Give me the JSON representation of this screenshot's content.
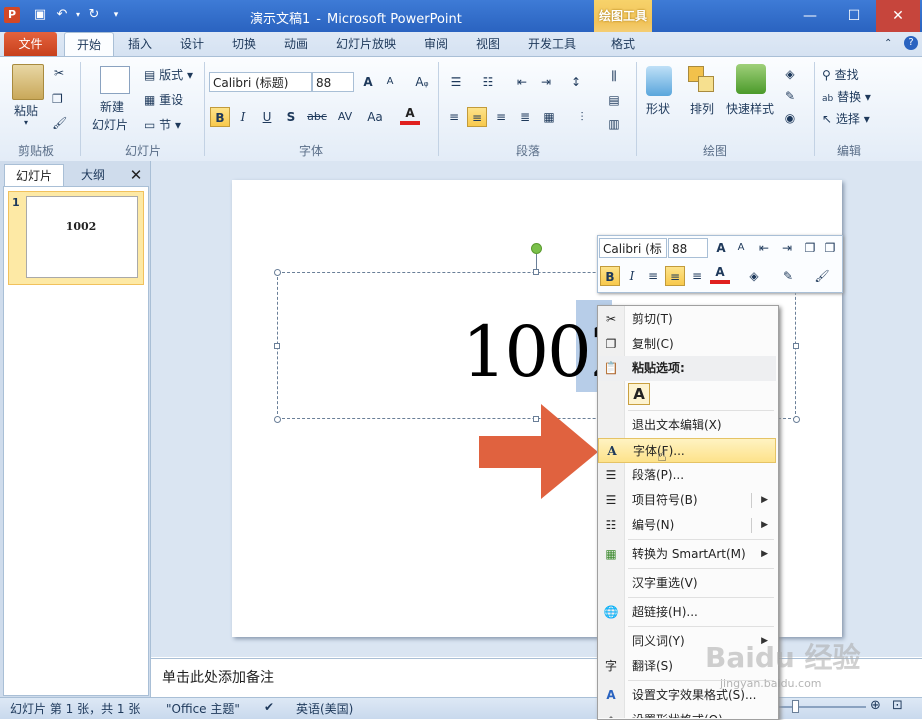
{
  "window": {
    "title_doc": "演示文稿1",
    "title_sep": "-",
    "title_app": "Microsoft PowerPoint",
    "contextual_tab_group": "绘图工具",
    "app_icon": "P"
  },
  "tabs": [
    "文件",
    "开始",
    "插入",
    "设计",
    "切换",
    "动画",
    "幻灯片放映",
    "审阅",
    "视图",
    "开发工具",
    "格式"
  ],
  "ribbon": {
    "clipboard": {
      "paste": "粘贴",
      "label": "剪贴板"
    },
    "slides": {
      "new_slide_1": "新建",
      "new_slide_2": "幻灯片",
      "layout": "版式",
      "reset": "重设",
      "section": "节",
      "label": "幻灯片"
    },
    "font": {
      "font_name": "Calibri (标题)",
      "font_size": "88",
      "label": "字体",
      "bold": "B",
      "italic": "I",
      "underline": "U",
      "shadow": "S",
      "strike": "abc",
      "spacing": "AV",
      "case": "Aa",
      "color": "A",
      "grow": "A",
      "shrink": "A"
    },
    "paragraph": {
      "label": "段落"
    },
    "drawing": {
      "shapes": "形状",
      "arrange": "排列",
      "quick_styles": "快速样式",
      "label": "绘图"
    },
    "editing": {
      "find": "查找",
      "replace": "替换",
      "select": "选择",
      "label": "编辑"
    }
  },
  "left_pane": {
    "tab_slides": "幻灯片",
    "tab_outline": "大纲",
    "close": "✕",
    "slide_number": "1",
    "thumb_text": "1002"
  },
  "slide": {
    "text_main": "100",
    "text_selected": "2"
  },
  "mini_toolbar": {
    "font": "Calibri (标",
    "size": "88"
  },
  "context_menu": {
    "cut": "剪切(T)",
    "copy": "复制(C)",
    "paste_options": "粘贴选项:",
    "paste_keep_text": "A",
    "exit_edit": "退出文本编辑(X)",
    "font": "字体(F)...",
    "paragraph": "段落(P)...",
    "bullets": "项目符号(B)",
    "numbering": "编号(N)",
    "smartart": "转换为 SmartArt(M)",
    "reconversion": "汉字重选(V)",
    "hyperlink": "超链接(H)...",
    "synonyms": "同义词(Y)",
    "translate": "翻译(S)",
    "text_effects": "设置文字效果格式(S)...",
    "shape_format": "设置形状格式(O)..."
  },
  "notes": {
    "placeholder": "单击此处添加备注"
  },
  "status": {
    "slide_info": "幻灯片 第 1 张，共 1 张",
    "theme": "\"Office 主题\"",
    "language": "英语(美国)"
  },
  "watermark": {
    "brand": "Baidu 经验",
    "url": "jingyan.baidu.com"
  },
  "colors": {
    "accent": "#2a63c0",
    "file_tab": "#d24726",
    "highlight": "#fde28a",
    "arrow": "#e0623f"
  }
}
